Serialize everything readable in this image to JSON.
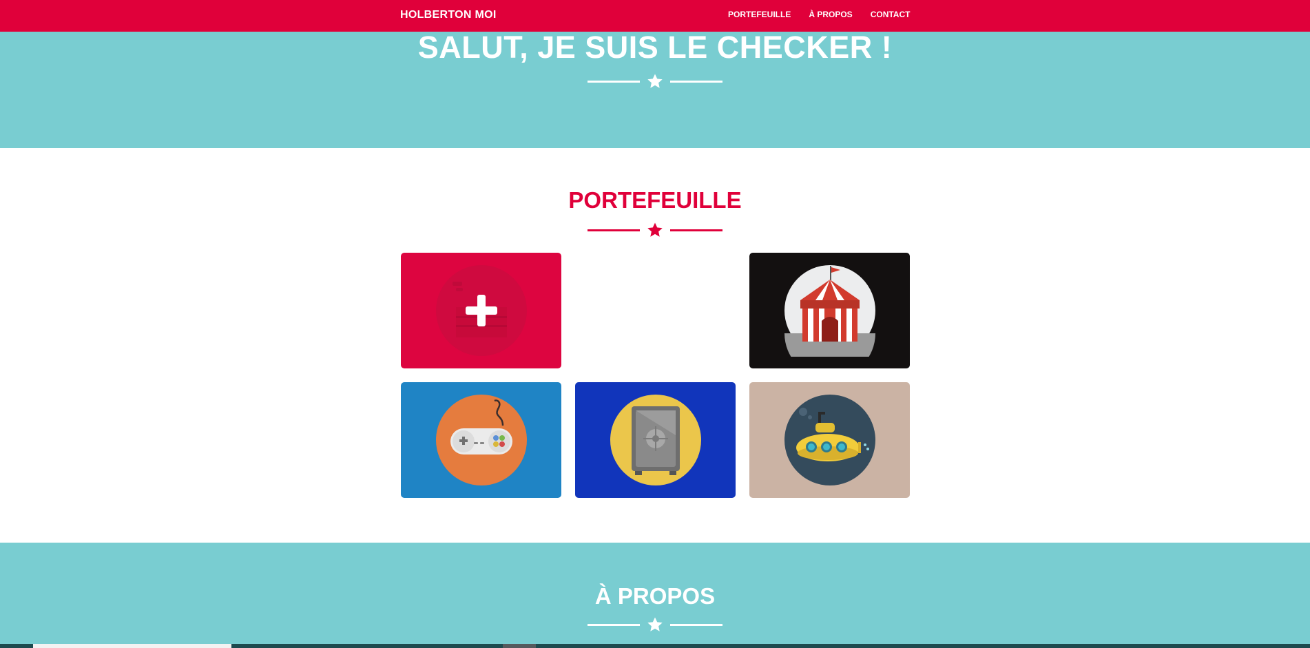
{
  "navbar": {
    "brand": "HOLBERTON MOI",
    "links": [
      "PORTEFEUILLE",
      "À PROPOS",
      "CONTACT"
    ]
  },
  "hero": {
    "title": "SALUT, JE SUIS LE CHECKER !"
  },
  "portfolio": {
    "title": "PORTEFEUILLE",
    "items": [
      {
        "icon": "cake-plus-icon",
        "background": "#dd0540"
      },
      {
        "icon": "circus-tent-icon",
        "background": "#131010"
      },
      {
        "icon": "game-controller-icon",
        "background": "#1f84c5"
      },
      {
        "icon": "safe-icon",
        "background": "#1135bb"
      },
      {
        "icon": "submarine-icon",
        "background": "#cbb3a4"
      }
    ]
  },
  "about": {
    "title": "À PROPOS"
  },
  "colors": {
    "primary": "#e0003a",
    "teal": "#79cdd1",
    "white": "#ffffff"
  }
}
